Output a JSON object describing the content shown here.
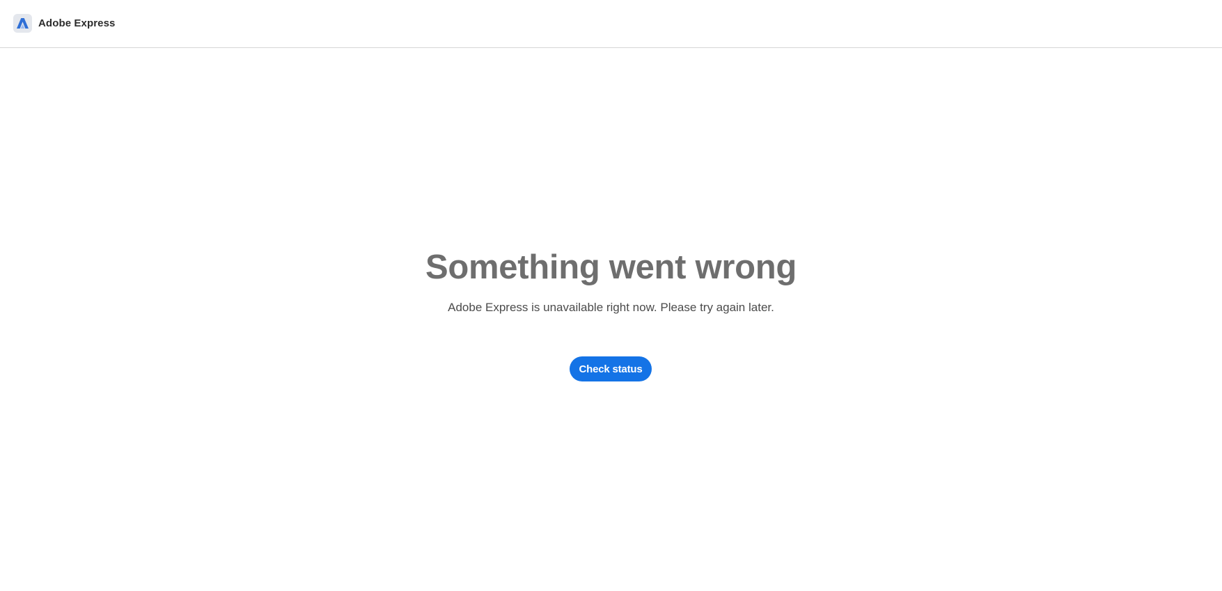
{
  "header": {
    "app_name": "Adobe Express",
    "logo_icon": "adobe-express-logo-icon"
  },
  "main": {
    "title": "Something went wrong",
    "message": "Adobe Express is unavailable right now. Please try again later.",
    "check_status_label": "Check status"
  },
  "colors": {
    "accent": "#1473e6",
    "title": "#6e6e6e",
    "message": "#4b4b4b",
    "logo_mark": "#2f6fd6",
    "logo_bg": "#e4e7ed"
  }
}
